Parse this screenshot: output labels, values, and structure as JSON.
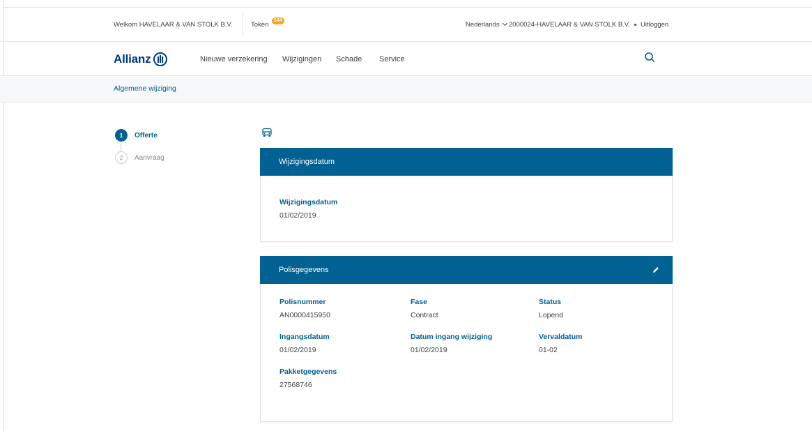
{
  "topbar": {
    "welcome": "Welkom HAVELAAR & VAN STOLK B.V.",
    "token_label": "Token",
    "token_count": "144",
    "language": "Nederlands",
    "account": "2000024-HAVELAAR & VAN STOLK B.V.",
    "logout": "Uitloggen"
  },
  "nav": {
    "logo": "Allianz",
    "items": [
      {
        "label": "Nieuwe verzekering"
      },
      {
        "label": "Wijzigingen"
      },
      {
        "label": "Schade"
      },
      {
        "label": "Service"
      }
    ],
    "search_icon": "search-icon"
  },
  "page": {
    "subtitle": "Algemene wijziging"
  },
  "stepper": {
    "steps": [
      {
        "number": "1",
        "label": "Offerte"
      },
      {
        "number": "2",
        "label": "Aanvraag"
      }
    ]
  },
  "cards": {
    "change_date": {
      "title": "Wijzigingsdatum",
      "field_label": "Wijzigingsdatum",
      "field_value": "01/02/2019"
    },
    "policy": {
      "title": "Polisgegevens",
      "fields": [
        {
          "label": "Polisnummer",
          "value": "AN0000415950"
        },
        {
          "label": "Fase",
          "value": "Contract"
        },
        {
          "label": "Status",
          "value": "Lopend"
        },
        {
          "label": "Ingangsdatum",
          "value": "01/02/2019"
        },
        {
          "label": "Datum ingang wijziging",
          "value": "01/02/2019"
        },
        {
          "label": "Vervaldatum",
          "value": "01-02"
        },
        {
          "label": "Pakketgegevens",
          "value": "27568746"
        }
      ]
    }
  },
  "colors": {
    "primary": "#006192",
    "brand": "#003781",
    "badge": "#f5a623"
  }
}
